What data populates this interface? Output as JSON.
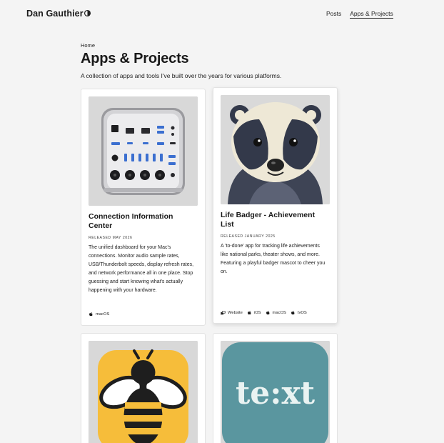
{
  "site": {
    "title": "Dan Gauthier",
    "theme_icon": "half-moon-icon"
  },
  "nav": {
    "items": [
      {
        "label": "Posts",
        "active": false
      },
      {
        "label": "Apps & Projects",
        "active": true
      }
    ]
  },
  "page": {
    "breadcrumb": "Home",
    "title": "Apps & Projects",
    "description": "A collection of apps and tools I've built over the years for various platforms."
  },
  "apps": [
    {
      "name": "Connection Information Center",
      "image": "mac-connection-ports-icon",
      "released": "Released May 2026",
      "description": "The unified dashboard for your Mac's connections. Monitor audio sample rates, USB/Thunderbolt speeds, display refresh rates, and network performance all in one place. Stop guessing and start knowing what's actually happening with your hardware.",
      "platforms": [
        {
          "label": "macOS",
          "icon": "apple-icon"
        }
      ]
    },
    {
      "name": "Life Badger - Achievement List",
      "image": "badger-mascot",
      "released": "Released January 2025",
      "description": "A 'to-done' app for tracking life achievements like national parks, theater shows, and more. Featuring a playful badger mascot to cheer you on.",
      "platforms": [
        {
          "label": "Website",
          "icon": "website-icon"
        },
        {
          "label": "iOS",
          "icon": "apple-icon"
        },
        {
          "label": "macOS",
          "icon": "apple-icon"
        },
        {
          "label": "tvOS",
          "icon": "apple-icon"
        }
      ]
    },
    {
      "name": "",
      "image": "bee-app-icon"
    },
    {
      "name": "",
      "image": "text-app-icon",
      "logo_text": "te:xt"
    }
  ],
  "colors": {
    "background": "#f4f4f4",
    "card": "#ffffff",
    "bee_yellow": "#f6bd3a",
    "text_teal": "#5a969f"
  }
}
